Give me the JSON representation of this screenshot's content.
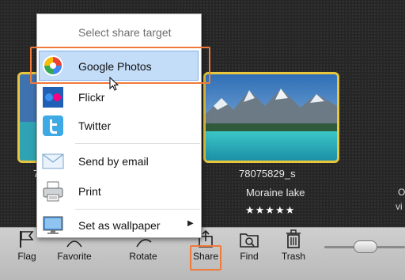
{
  "gallery": {
    "left_caption": "7",
    "main_filename": "78075829_s",
    "main_title": "Moraine lake",
    "main_rating": "★★★★★",
    "right_edge_1": "O",
    "right_edge_2": "vi"
  },
  "share_menu": {
    "header": "Select share target",
    "items": [
      {
        "label": "Google Photos",
        "icon": "google-photos-icon",
        "selected": true
      },
      {
        "label": "Flickr",
        "icon": "flickr-icon"
      },
      {
        "label": "Twitter",
        "icon": "twitter-icon"
      },
      {
        "label": "Send by email",
        "icon": "email-envelope-icon"
      },
      {
        "label": "Print",
        "icon": "printer-icon"
      },
      {
        "label": "Set as wallpaper",
        "icon": "monitor-icon",
        "has_submenu": true
      }
    ]
  },
  "toolbar": {
    "flag": "Flag",
    "favorite": "Favorite",
    "rotate": "Rotate",
    "share": "Share",
    "find": "Find",
    "trash": "Trash"
  },
  "colors": {
    "highlight": "#f07a3a",
    "thumb_border": "#e7c53c",
    "selection": "#c3dcf7"
  }
}
